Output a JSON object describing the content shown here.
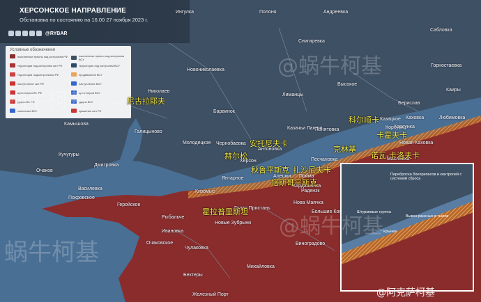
{
  "header": {
    "title": "ХЕРСОНСКОЕ НАПРАВЛЕНИЕ",
    "subtitle": "Обстановка по состоянию на 16.00 27 ноября 2023 г.",
    "handle": "@RYBAR"
  },
  "legend": {
    "heading": "Условные обозначения",
    "items": [
      "населенные пункты под контролем РФ",
      "населенные пункты под контролем ВСУ",
      "территория под контролем сил РФ",
      "территория под контролем ВСУ",
      "территория подконтрольная РФ",
      "продвижение ВСУ",
      "наступление сил РФ",
      "наступление ВСУ",
      "артиллерия ВС РФ",
      "артиллерия ВСУ",
      "удары ВС РФ",
      "удары ВСУ",
      "скопление ВСУ",
      "сражение сил РФ"
    ]
  },
  "towns": [
    "Ингулка",
    "Полоня",
    "Андреевка",
    "Снигиревка",
    "Николаев",
    "Новониколаевка",
    "Барвинок",
    "Лиманцы",
    "Высокое",
    "Камышова",
    "Галицыново",
    "Молодецкое",
    "Понятовка",
    "Берислав",
    "Каховка",
    "Корсунка",
    "Казацкое",
    "Любимовка",
    "Сабловка",
    "Горностаевка",
    "Каиры",
    "Кучугуры",
    "Дмитровка",
    "Очаков",
    "Покровское",
    "Василевка",
    "Геройское",
    "Рыбальче",
    "Кизомыс",
    "Херсон",
    "Антоновка",
    "Чернобаевка",
    "Янтарное",
    "Алешки",
    "Казачьи Лагери",
    "Песчановка",
    "Нова Маячка",
    "Большие Копани",
    "Радензк",
    "Голая Пристань",
    "Новые Зубрыни",
    "Ивановка",
    "Очаковское",
    "Чулаковка",
    "Виноградово",
    "Бехтеры",
    "Михайловка",
    "Железный Порт",
    "Крынки",
    "Масловка",
    "Новая Каховка",
    "Корсунка",
    "Пойма",
    "Кардашинка"
  ],
  "annotations_cn": [
    "尼古拉耶夫",
    "安托尼夫卡",
    "赫尔松",
    "秋鲁平斯克",
    "扎沙尼夫卡",
    "塔斯哥平斯克",
    "霍拉普里斯坦",
    "科尔顺卡",
    "卡霍夫卡",
    "克林基",
    "诺瓦-卡洛夫卡",
    "克林基"
  ],
  "inset": {
    "labels": [
      "Переброска боеприпасов и контролей с системой сброса",
      "Штурмовые группы",
      "Вывоз раненых в тылов",
      "Крынки"
    ]
  },
  "watermark": {
    "cn_name": "蜗牛柯基",
    "weibo": "@阿克萨柯基",
    "handle": "@蜗牛柯基"
  },
  "colors": {
    "water": "#4a6f94",
    "land_ua": "#3d4f62",
    "land_ru": "#8b2a2a",
    "highlight_cn": "#f5e84a",
    "front_hatch": "#d9823a"
  }
}
